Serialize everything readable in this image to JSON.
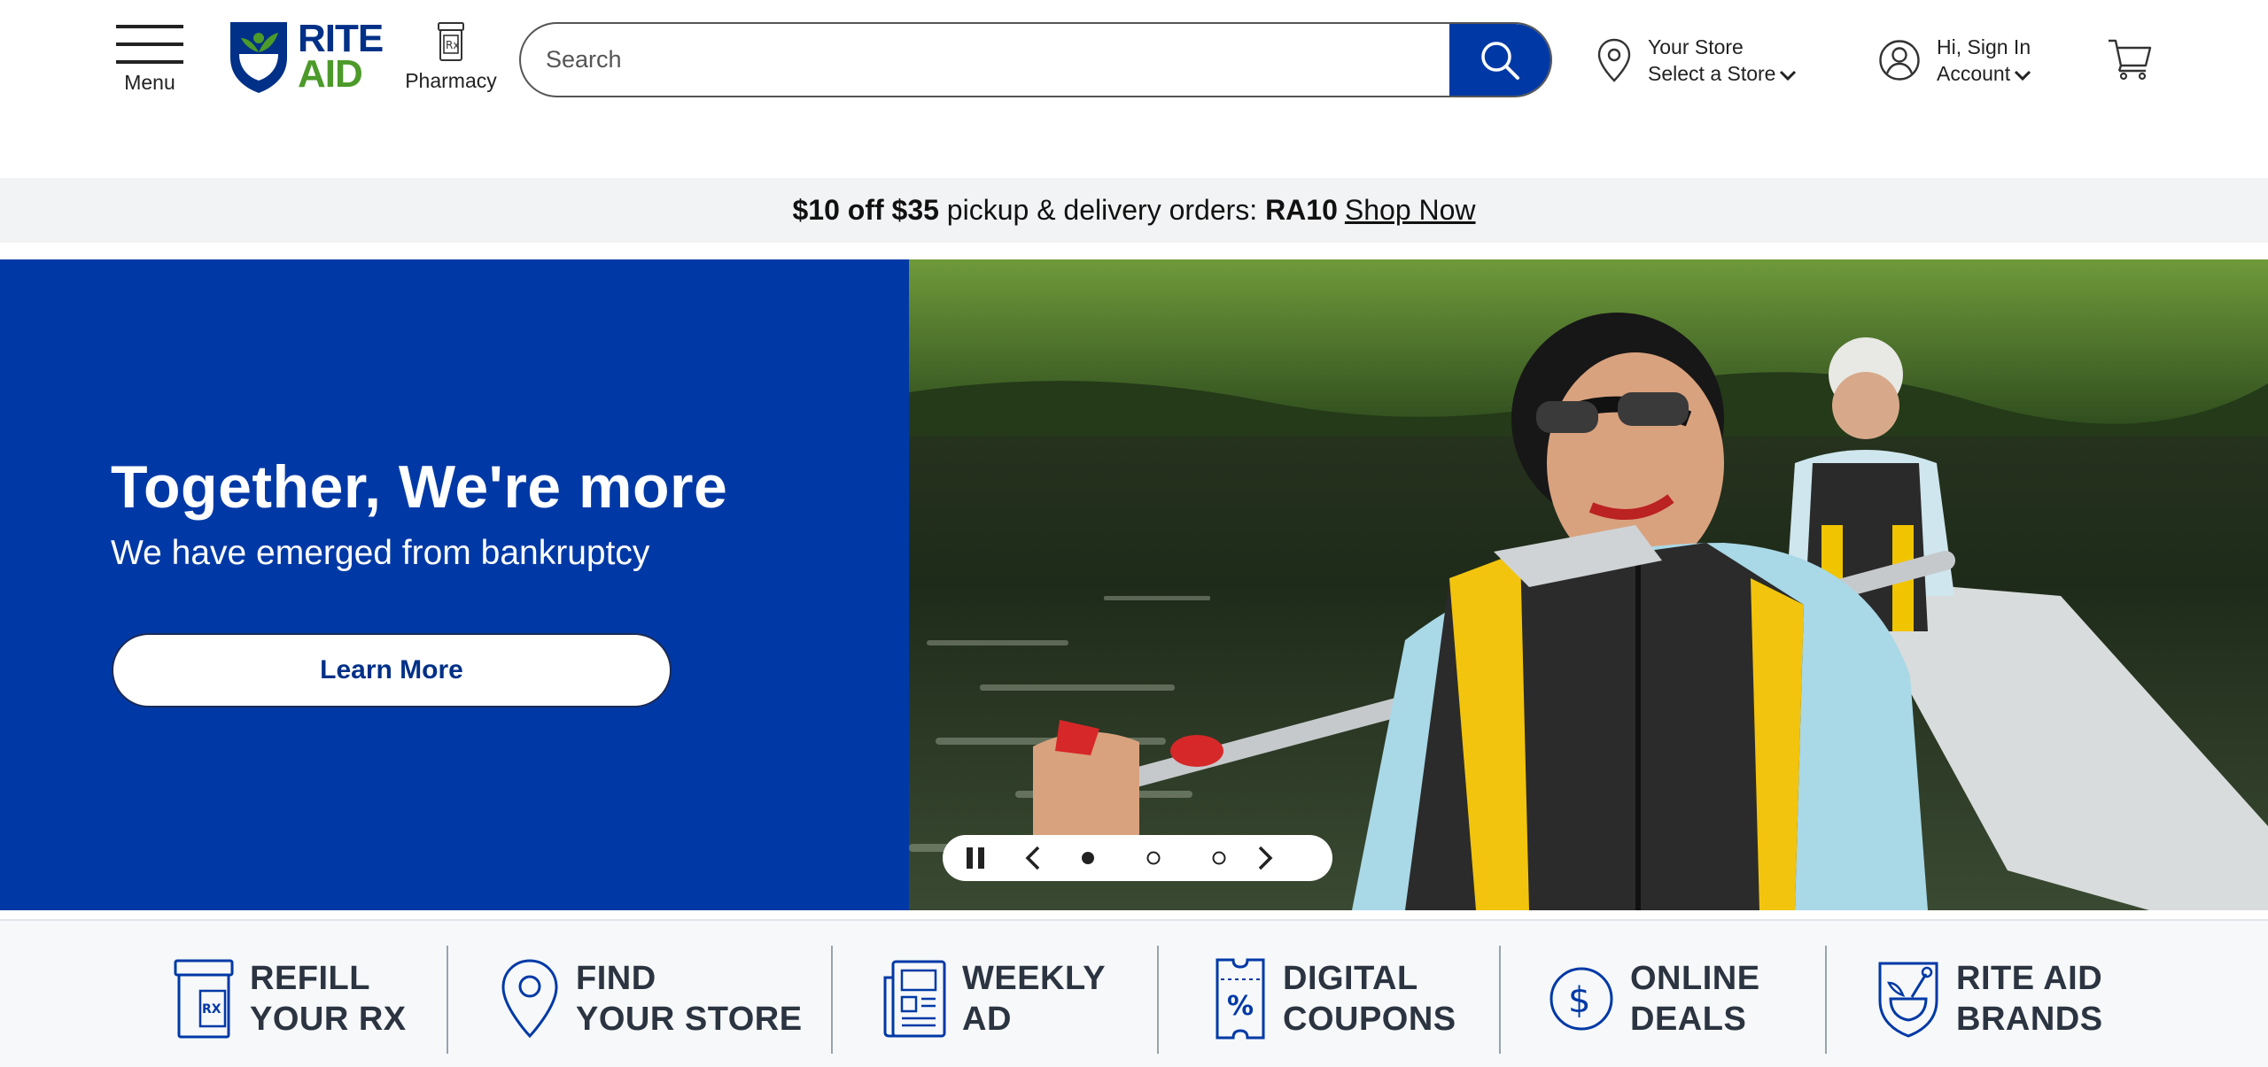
{
  "header": {
    "menu_label": "Menu",
    "logo_line1": "RITE",
    "logo_line2": "AID",
    "pharmacy_label": "Pharmacy",
    "search_placeholder": "Search",
    "store_line1": "Your Store",
    "store_line2": "Select a Store",
    "account_line1": "Hi, Sign In",
    "account_line2": "Account"
  },
  "promo": {
    "bold1": "$10 off $35",
    "text": "pickup & delivery orders:",
    "code": "RA10",
    "link": "Shop Now"
  },
  "hero": {
    "title": "Together, We're more",
    "subtitle": "We have emerged from bankruptcy",
    "cta": "Learn More",
    "slides_total": 3,
    "active_slide": 1
  },
  "quick_links": [
    {
      "icon": "rx-bottle-icon",
      "line1": "REFILL",
      "line2": "YOUR RX"
    },
    {
      "icon": "location-pin-icon",
      "line1": "FIND",
      "line2": "YOUR STORE"
    },
    {
      "icon": "newspaper-icon",
      "line1": "WEEKLY",
      "line2": "AD"
    },
    {
      "icon": "coupon-icon",
      "line1": "DIGITAL",
      "line2": "COUPONS"
    },
    {
      "icon": "dollar-circle-icon",
      "line1": "ONLINE",
      "line2": "DEALS"
    },
    {
      "icon": "mortar-pestle-icon",
      "line1": "RITE AID",
      "line2": "BRANDS"
    }
  ],
  "colors": {
    "brand_blue": "#0039a6",
    "logo_green": "#4c9a2a",
    "navy": "#003087"
  }
}
